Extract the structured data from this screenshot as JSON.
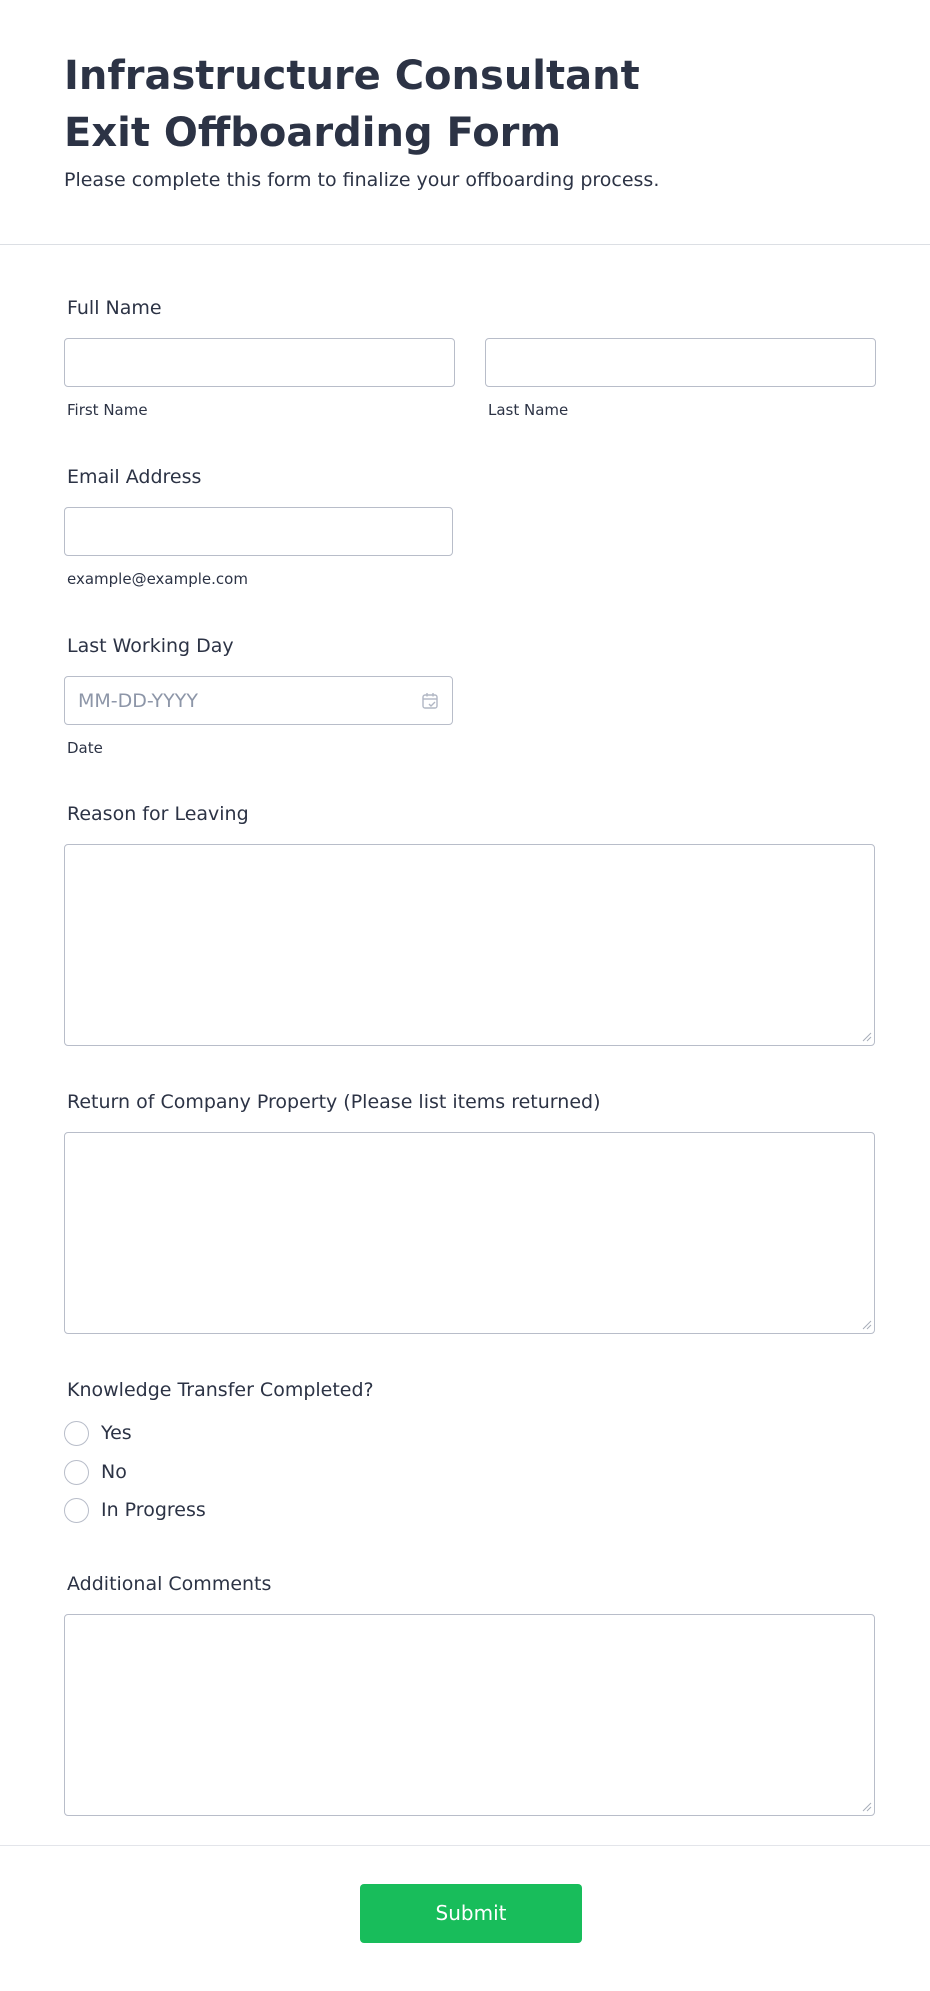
{
  "header": {
    "title": "Infrastructure Consultant Exit Offboarding Form",
    "subtitle": "Please complete this form to finalize your offboarding process."
  },
  "fields": {
    "full_name": {
      "label": "Full Name",
      "first_sublabel": "First Name",
      "last_sublabel": "Last Name",
      "first_value": "",
      "last_value": ""
    },
    "email": {
      "label": "Email Address",
      "sublabel": "example@example.com",
      "value": ""
    },
    "last_working_day": {
      "label": "Last Working Day",
      "placeholder": "MM-DD-YYYY",
      "sublabel": "Date",
      "icon": "calendar-icon"
    },
    "reason": {
      "label": "Reason for Leaving",
      "value": ""
    },
    "property": {
      "label": "Return of Company Property (Please list items returned)",
      "value": ""
    },
    "knowledge_transfer": {
      "label": "Knowledge Transfer Completed?",
      "options": [
        "Yes",
        "No",
        "In Progress"
      ],
      "selected": null
    },
    "comments": {
      "label": "Additional Comments",
      "value": ""
    }
  },
  "submit": {
    "label": "Submit"
  },
  "colors": {
    "text": "#2c3345",
    "border": "#b8bdc9",
    "placeholder": "#8d96a8",
    "submit": "#18bd5b",
    "divider": "#dcdfe4"
  }
}
